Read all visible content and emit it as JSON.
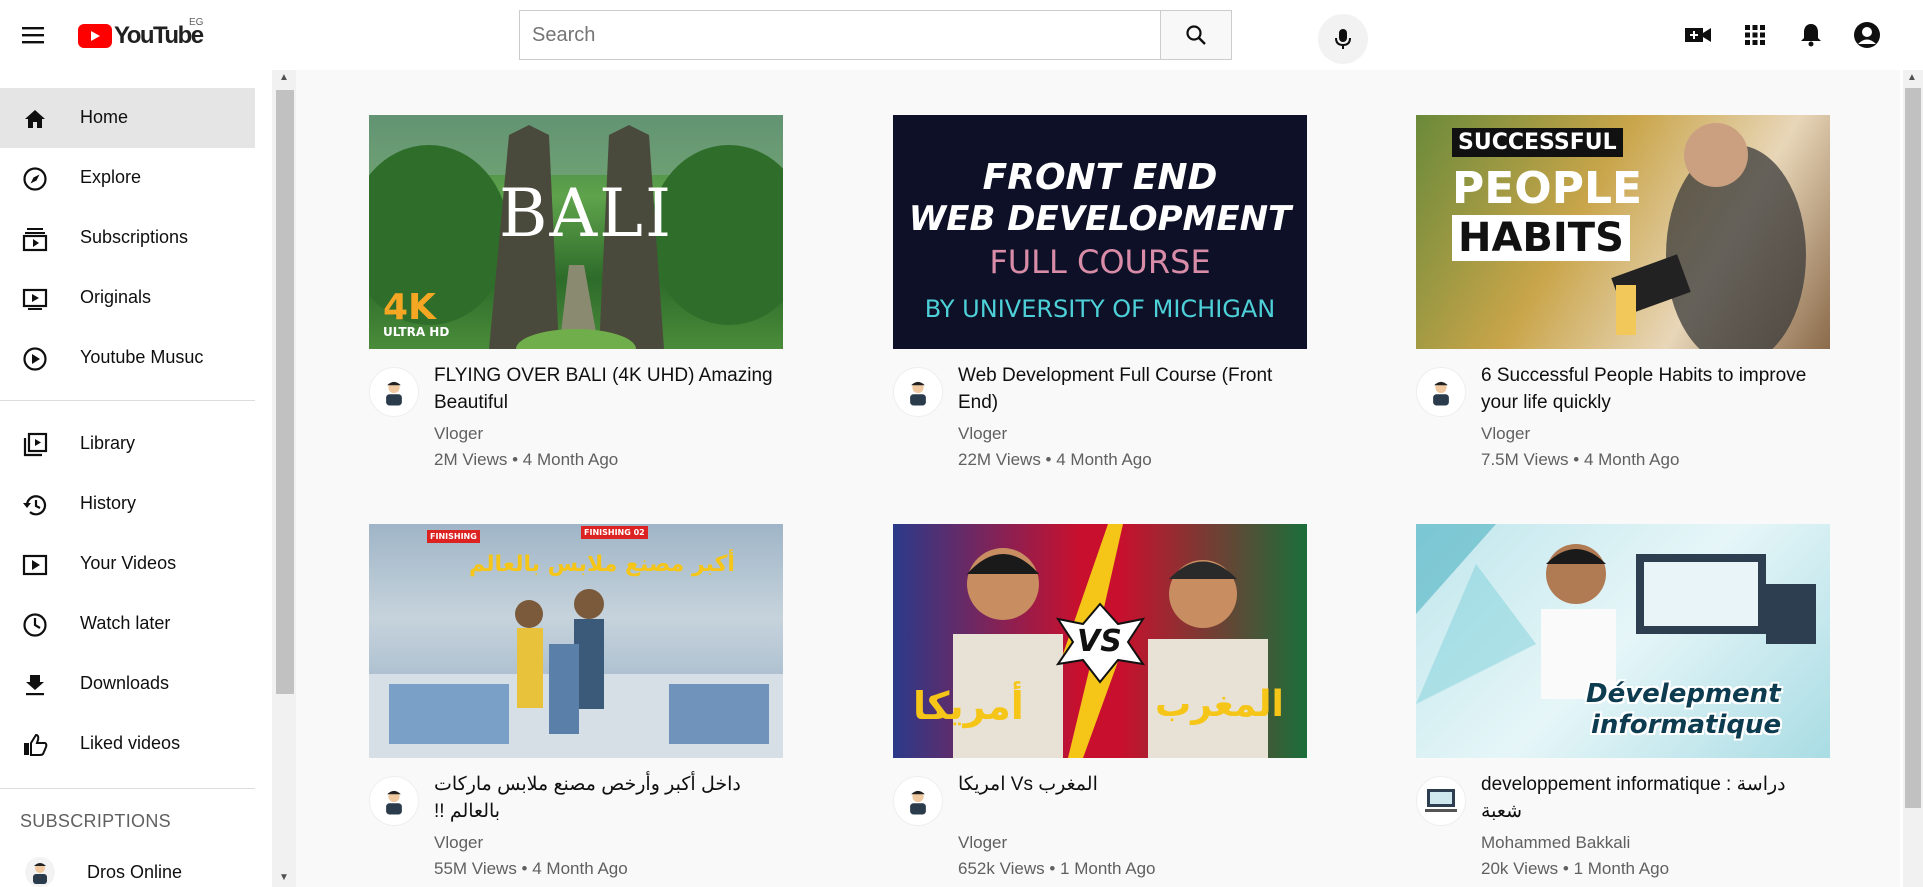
{
  "header": {
    "logo_text": "YouTube",
    "country_code": "EG",
    "search_placeholder": "Search"
  },
  "sidebar": {
    "primary": [
      {
        "label": "Home",
        "icon": "home-icon",
        "active": true
      },
      {
        "label": "Explore",
        "icon": "compass-icon"
      },
      {
        "label": "Subscriptions",
        "icon": "subscriptions-icon"
      },
      {
        "label": "Originals",
        "icon": "originals-icon"
      },
      {
        "label": "Youtube Musuc",
        "icon": "music-play-icon"
      }
    ],
    "secondary": [
      {
        "label": "Library",
        "icon": "library-icon"
      },
      {
        "label": "History",
        "icon": "history-icon"
      },
      {
        "label": "Your Videos",
        "icon": "your-videos-icon"
      },
      {
        "label": "Watch later",
        "icon": "clock-icon"
      },
      {
        "label": "Downloads",
        "icon": "download-icon"
      },
      {
        "label": "Liked videos",
        "icon": "thumbs-up-icon"
      }
    ],
    "subscriptions_header": "SUBSCRIPTIONS",
    "subscriptions": [
      {
        "label": "Dros Online"
      }
    ]
  },
  "videos": [
    {
      "title": "FLYING OVER BALI (4K UHD) Amazing Beautiful",
      "channel": "Vloger",
      "meta": "2M Views • 4 Month Ago",
      "thumb_text": "BALI",
      "thumb_badge": "4K",
      "thumb_badge2": "ULTRA HD"
    },
    {
      "title": "Web Development Full Course (Front End)",
      "channel": "Vloger",
      "meta": "22M Views • 4 Month Ago",
      "thumb_l1": "FRONT END",
      "thumb_l2": "WEB DEVELOPMENT",
      "thumb_l3": "FULL COURSE",
      "thumb_l4": "BY UNIVERSITY OF MICHIGAN"
    },
    {
      "title": "6 Successful People Habits to improve your life quickly",
      "channel": "Vloger",
      "meta": "7.5M Views • 4 Month Ago",
      "thumb_l1": "SUCCESSFUL",
      "thumb_l2": "PEOPLE",
      "thumb_l3": "HABITS"
    },
    {
      "title": "داخل أكبر وأرخص مصنع ملابس ماركات بالعالم !!",
      "channel": "Vloger",
      "meta": "55M Views • 4 Month Ago",
      "thumb_text": "أكبر مصنع ملابس بالعالم",
      "thumb_sign1": "FINISHING",
      "thumb_sign2": "FINISHING 02"
    },
    {
      "title": "المغرب Vs امريكا",
      "channel": "Vloger",
      "meta": "652k Views • 1 Month Ago",
      "thumb_left": "أمريكا",
      "thumb_right": "المغرب",
      "thumb_vs": "VS"
    },
    {
      "title": "developpement informatique : دراسة شعبة",
      "channel": "Mohammed Bakkali",
      "meta": "20k Views • 1 Month Ago",
      "thumb_l1": "Dévelepment",
      "thumb_l2": "informatique"
    }
  ]
}
